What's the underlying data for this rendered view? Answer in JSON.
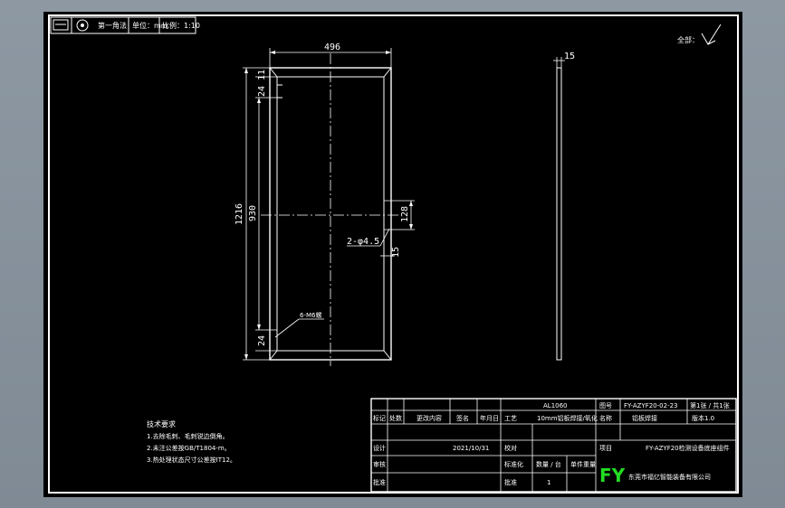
{
  "header": {
    "view_projection": "第一角法",
    "unit": "单位：mm",
    "scale": "比例：1:10"
  },
  "roughness": {
    "label": "全部："
  },
  "front_view": {
    "width_dim": "496",
    "height_overall": "1216",
    "height_inner": "930",
    "top_offset_a": "11",
    "top_offset_b": "24",
    "bottom_offset": "24",
    "hole_spacing": "128",
    "hole_label": "2-φ4.5",
    "hole_offset": "15",
    "thread_label": "6-M6螺"
  },
  "side_view": {
    "thickness": "15"
  },
  "tech_requirements": {
    "title": "技术要求",
    "items": [
      "1.去除毛刺、毛刺锐边倒角。",
      "2.未注公差按GB/T1804-m。",
      "3.热处理状态尺寸公差按IT12。"
    ]
  },
  "title_block": {
    "material": "AL1060",
    "drawing_no_label": "图号",
    "drawing_no": "FY-AZYF20-02-23",
    "sheet": "第1张 / 共1张",
    "part_label": "名称",
    "part_value": "铝板焊接",
    "version": "版本1.0",
    "finish": "10mm铝板焊接/氧化",
    "project_label": "项目",
    "project_value": "FY-AZYF20检测设备底座组件",
    "headers": [
      "标记",
      "处数",
      "更改内容",
      "签名",
      "年月日"
    ],
    "row_design": "设计",
    "date": "2021/10/31",
    "row_check": "校对",
    "row_review": "审核",
    "row_approve": "批准",
    "row_standard": "标准化",
    "row_process": "工艺",
    "row_qty": "数量 / 台",
    "row_weight": "单件重量",
    "qty": "1",
    "logo": "FY",
    "company": "东莞市福亿智能装备有限公司"
  }
}
